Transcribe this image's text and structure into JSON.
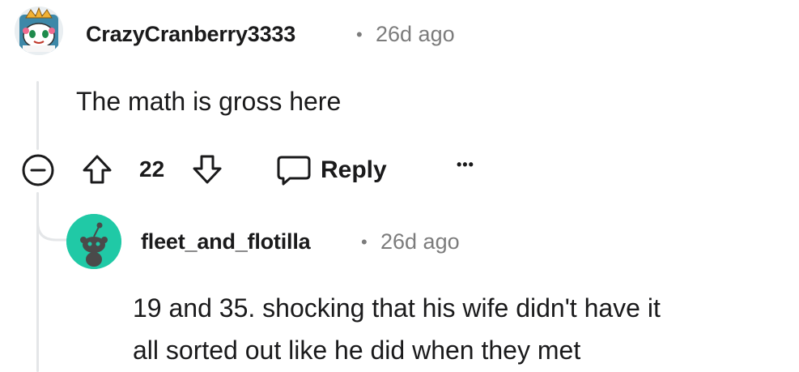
{
  "comments": [
    {
      "username": "CrazyCranberry3333",
      "separator": "•",
      "timestamp": "26d ago",
      "body": "The math is gross here",
      "votes": "22",
      "reply_label": "Reply",
      "more_label": "•••",
      "avatar_icon": "crowned-snoo-avatar-icon"
    },
    {
      "username": "fleet_and_flotilla",
      "separator": "•",
      "timestamp": "26d ago",
      "body_lines": [
        "19 and 35. shocking that his wife didn't have it",
        "all sorted out like he did when they met"
      ],
      "avatar_color": "#20c9a6",
      "avatar_icon": "snoo-avatar-icon"
    }
  ]
}
